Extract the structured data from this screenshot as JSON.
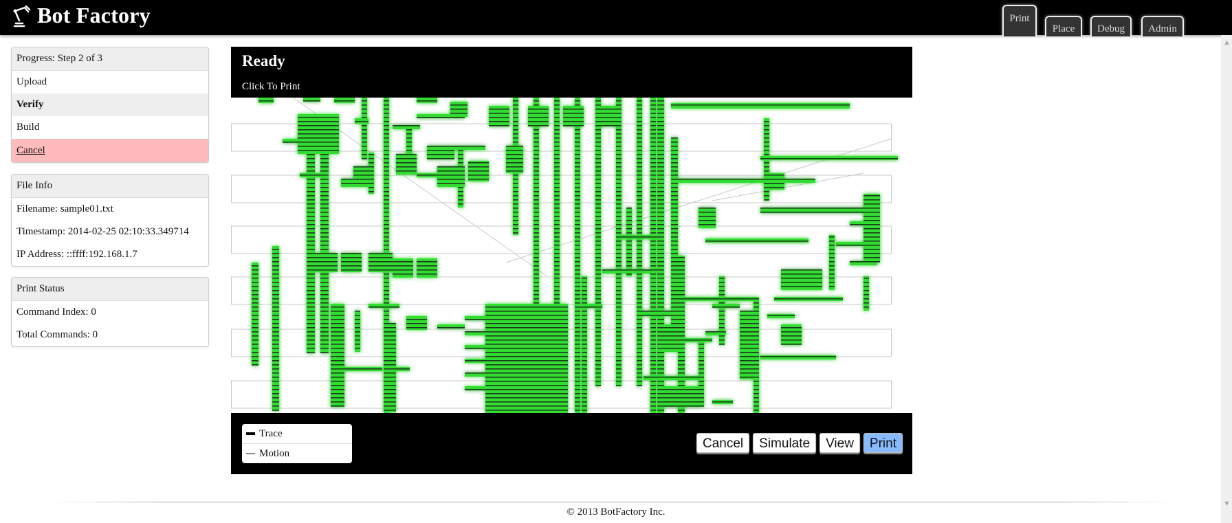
{
  "header": {
    "title": "Bot Factory",
    "logo_icon": "robot-arm-icon",
    "nav_tabs": [
      {
        "label": "Print",
        "active": true
      },
      {
        "label": "Place",
        "active": false
      },
      {
        "label": "Debug",
        "active": false
      },
      {
        "label": "Admin",
        "active": false
      }
    ]
  },
  "progress": {
    "title": "Progress: Step 2 of 3",
    "steps": [
      {
        "label": "Upload",
        "current": false
      },
      {
        "label": "Verify",
        "current": true
      },
      {
        "label": "Build",
        "current": false
      }
    ],
    "cancel_label": "Cancel"
  },
  "file_info": {
    "title": "File Info",
    "filename": "Filename: sample01.txt",
    "timestamp": "Timestamp: 2014-02-25 02:10:33.349714",
    "ip_address": "IP Address: ::ffff:192.168.1.7"
  },
  "print_status": {
    "title": "Print Status",
    "command_index": "Command Index: 0",
    "total_commands": "Total Commands: 0"
  },
  "main": {
    "status_title": "Ready",
    "status_subtitle": "Click To Print",
    "legend": {
      "trace_label": "Trace",
      "motion_label": "Motion"
    },
    "buttons": {
      "cancel": "Cancel",
      "simulate": "Simulate",
      "view": "View",
      "print": "Print"
    },
    "colors": {
      "trace_green": "#33dd33",
      "trace_scanline": "#1a3a1a",
      "motion_gray": "#bbbbbb",
      "primary_button": "#88bbff",
      "cancel_row": "#ffbbbb"
    }
  },
  "footer": {
    "copyright": "© 2013 BotFactory Inc."
  }
}
